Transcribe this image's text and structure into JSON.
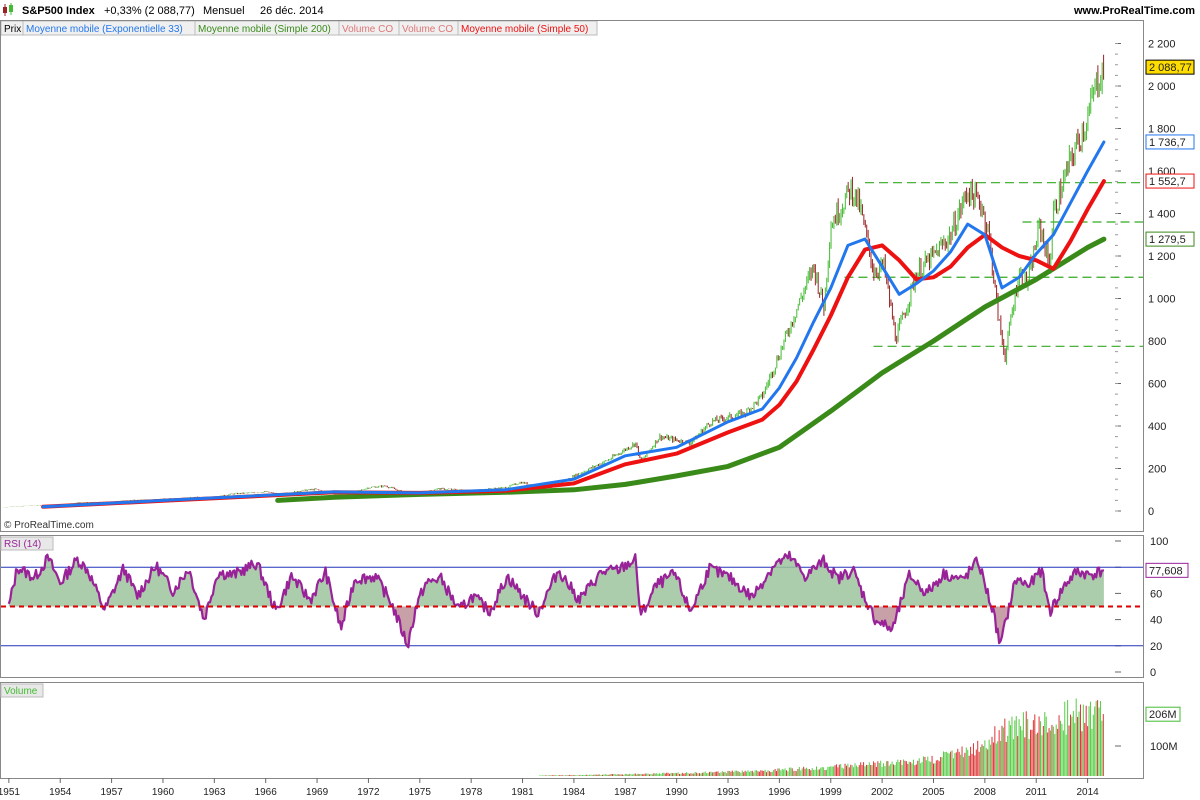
{
  "header": {
    "instrument": "S&P500 Index",
    "change": "+0,33% (2 088,77)",
    "period": "Mensuel",
    "date": "26 déc. 2014",
    "website": "www.ProRealTime.com"
  },
  "legend": {
    "price": "Prix",
    "ema33": "Moyenne mobile (Exponentielle 33)",
    "sma200": "Moyenne mobile (Simple 200)",
    "vol1": "Volume CO",
    "vol2": "Volume CO",
    "sma50": "Moyenne mobile (Simple 50)"
  },
  "watermark": "© ProRealTime.com",
  "colors": {
    "ema33": "#2277ee",
    "sma200": "#3a8a1a",
    "sma50": "#ee1111",
    "up": "#44bb33",
    "down": "#992222",
    "rsi": "#992299",
    "rsi_fill": "#9cc49c",
    "last_price_bg": "#ffdd00",
    "support_line": "#33aa22"
  },
  "x_ticks": [
    "1951",
    "1954",
    "1957",
    "1960",
    "1963",
    "1966",
    "1969",
    "1972",
    "1975",
    "1978",
    "1981",
    "1984",
    "1987",
    "1990",
    "1993",
    "1996",
    "1999",
    "2002",
    "2005",
    "2008",
    "2011",
    "2014"
  ],
  "chart_data": [
    {
      "type": "line",
      "panel": "Prix",
      "title": "S&P500 Index",
      "xlabel": "",
      "ylabel": "",
      "x_range": [
        1950.6,
        2015.6
      ],
      "ylim": [
        -60,
        2260
      ],
      "y_ticks": [
        "2 200",
        "2 000",
        "1 800",
        "1 600",
        "1 400",
        "1 200",
        "1 000",
        "800",
        "600",
        "400",
        "200",
        "0"
      ],
      "y_tick_values": [
        2200,
        2000,
        1800,
        1600,
        1400,
        1200,
        1000,
        800,
        600,
        400,
        200,
        0
      ],
      "last_labels": [
        {
          "series": "price",
          "text": "2 088,77",
          "value": 2088.77
        },
        {
          "series": "ema33",
          "text": "1 736,7",
          "value": 1736.7
        },
        {
          "series": "sma50",
          "text": "1 552,7",
          "value": 1552.7
        },
        {
          "series": "sma200",
          "text": "1 279,5",
          "value": 1279.5
        }
      ],
      "price": {
        "x": [
          1950.6,
          1952,
          1954,
          1955,
          1957,
          1958,
          1960,
          1962,
          1962.5,
          1964,
          1966,
          1966.8,
          1968,
          1968.9,
          1970.5,
          1972,
          1973,
          1974.7,
          1976,
          1978,
          1980,
          1980.9,
          1982.6,
          1984,
          1986,
          1987.6,
          1987.9,
          1989,
          1990.8,
          1992,
          1994,
          1995,
          1996,
          1997,
          1998,
          1998.6,
          1999,
          2000.2,
          2000.7,
          2001.5,
          2002.1,
          2002.8,
          2003.5,
          2004,
          2005,
          2006,
          2007,
          2007.8,
          2008.2,
          2008.8,
          2009.2,
          2009.5,
          2010,
          2010.5,
          2011.2,
          2011.8,
          2012,
          2013,
          2014,
          2014.5,
          2014.95
        ],
        "values": [
          17,
          24,
          28,
          40,
          42,
          50,
          56,
          66,
          56,
          80,
          90,
          78,
          95,
          102,
          70,
          110,
          118,
          70,
          105,
          96,
          110,
          135,
          105,
          165,
          240,
          320,
          230,
          350,
          320,
          420,
          460,
          540,
          740,
          950,
          1150,
          960,
          1350,
          1520,
          1430,
          1130,
          1150,
          810,
          980,
          1120,
          1200,
          1300,
          1510,
          1440,
          1320,
          900,
          720,
          900,
          1120,
          1070,
          1345,
          1150,
          1400,
          1650,
          1850,
          2010,
          2088.77
        ]
      },
      "series": [
        {
          "name": "Moyenne mobile (Exponentielle 33)",
          "key": "ema33",
          "x": [
            1953,
            1960,
            1970,
            1975,
            1980,
            1984,
            1987,
            1990,
            1993,
            1995,
            1996,
            1997,
            1998,
            1999,
            2000,
            2001,
            2002,
            2003,
            2004,
            2005,
            2006,
            2007,
            2008,
            2009,
            2010,
            2011,
            2012,
            2013,
            2014,
            2014.95
          ],
          "values": [
            20,
            50,
            90,
            85,
            100,
            150,
            260,
            300,
            420,
            480,
            580,
            720,
            890,
            1050,
            1250,
            1280,
            1150,
            1020,
            1070,
            1130,
            1220,
            1350,
            1300,
            1050,
            1100,
            1210,
            1300,
            1450,
            1600,
            1736.7
          ]
        },
        {
          "name": "Moyenne mobile (Simple 50)",
          "key": "sma50",
          "x": [
            1953,
            1960,
            1970,
            1975,
            1980,
            1984,
            1987,
            1990,
            1993,
            1995,
            1996,
            1997,
            1998,
            1999,
            2000,
            2001,
            2002,
            2003,
            2004,
            2005,
            2006,
            2007,
            2008,
            2009,
            2010,
            2011,
            2012,
            2013,
            2014,
            2014.95
          ],
          "values": [
            20,
            48,
            88,
            85,
            95,
            130,
            220,
            270,
            370,
            430,
            500,
            610,
            760,
            920,
            1100,
            1230,
            1250,
            1180,
            1090,
            1100,
            1150,
            1240,
            1300,
            1240,
            1200,
            1180,
            1140,
            1270,
            1420,
            1552.7
          ]
        },
        {
          "name": "Moyenne mobile (Simple 200)",
          "key": "sma200",
          "x": [
            1966.7,
            1970,
            1975,
            1980,
            1984,
            1987,
            1990,
            1993,
            1996,
            1999,
            2002,
            2005,
            2008,
            2011,
            2014,
            2014.95
          ],
          "values": [
            50,
            65,
            78,
            88,
            100,
            125,
            165,
            210,
            300,
            470,
            650,
            800,
            960,
            1090,
            1240,
            1279.5
          ]
        }
      ],
      "support_levels": [
        1545,
        1360,
        1100,
        775
      ]
    },
    {
      "type": "line",
      "panel": "RSI",
      "title": "RSI (14)",
      "ylim": [
        0,
        100
      ],
      "y_ticks": [
        "100",
        "80",
        "60",
        "40",
        "20",
        "0"
      ],
      "y_tick_values": [
        100,
        80,
        60,
        40,
        20,
        0
      ],
      "overbought": 80,
      "oversold": 20,
      "midline": 50,
      "last_value_label": "77,608",
      "series": [
        {
          "name": "RSI (14)",
          "x": [
            1951,
            1951.5,
            1952.5,
            1953.3,
            1954,
            1955,
            1955.6,
            1956.6,
            1957.7,
            1958.5,
            1959.6,
            1960.6,
            1961.5,
            1962.4,
            1963.2,
            1964.1,
            1965.5,
            1966.6,
            1967.5,
            1968.6,
            1969.5,
            1970.4,
            1971.2,
            1972.4,
            1973.3,
            1974.3,
            1974.75,
            1975.3,
            1976.2,
            1977.3,
            1978.1,
            1979.1,
            1980.1,
            1981.2,
            1981.9,
            1983.1,
            1984.3,
            1985.6,
            1986.6,
            1987.6,
            1987.9,
            1988.8,
            1989.9,
            1990.8,
            1991.9,
            1993.1,
            1994.4,
            1995.7,
            1996.6,
            1997.5,
            1998.6,
            1999.4,
            2000.3,
            2000.8,
            2001.6,
            2002.6,
            2003.6,
            2004.6,
            2005.6,
            2006.7,
            2007.6,
            2008.5,
            2008.9,
            2009.8,
            2010.6,
            2011.3,
            2011.8,
            2012.7,
            2013.4,
            2014.1,
            2014.95
          ],
          "values": [
            50,
            80,
            72,
            87,
            68,
            86,
            78,
            47,
            79,
            58,
            81,
            62,
            79,
            40,
            76,
            74,
            83,
            46,
            73,
            55,
            76,
            33,
            71,
            73,
            54,
            20,
            48,
            67,
            72,
            47,
            58,
            46,
            73,
            55,
            45,
            78,
            55,
            76,
            78,
            86,
            42,
            66,
            75,
            46,
            79,
            72,
            57,
            82,
            88,
            73,
            85,
            71,
            78,
            62,
            40,
            32,
            74,
            60,
            75,
            70,
            85,
            45,
            20,
            71,
            66,
            78,
            46,
            67,
            77,
            74,
            77.608
          ]
        }
      ]
    },
    {
      "type": "bar",
      "panel": "Volume",
      "title": "Volume",
      "y_ticks": [
        "100M"
      ],
      "y_tick_values": [
        100
      ],
      "last_value_label": "206M",
      "start_year": 1982,
      "series": [
        {
          "name": "Volume",
          "x": [
            1982,
            1985,
            1990,
            1995,
            2000,
            2003,
            2005,
            2007,
            2008,
            2009,
            2010,
            2011,
            2012,
            2013,
            2014,
            2014.95
          ],
          "values": [
            2,
            4,
            10,
            18,
            35,
            50,
            60,
            90,
            110,
            160,
            180,
            190,
            200,
            215,
            220,
            206
          ]
        }
      ]
    }
  ]
}
